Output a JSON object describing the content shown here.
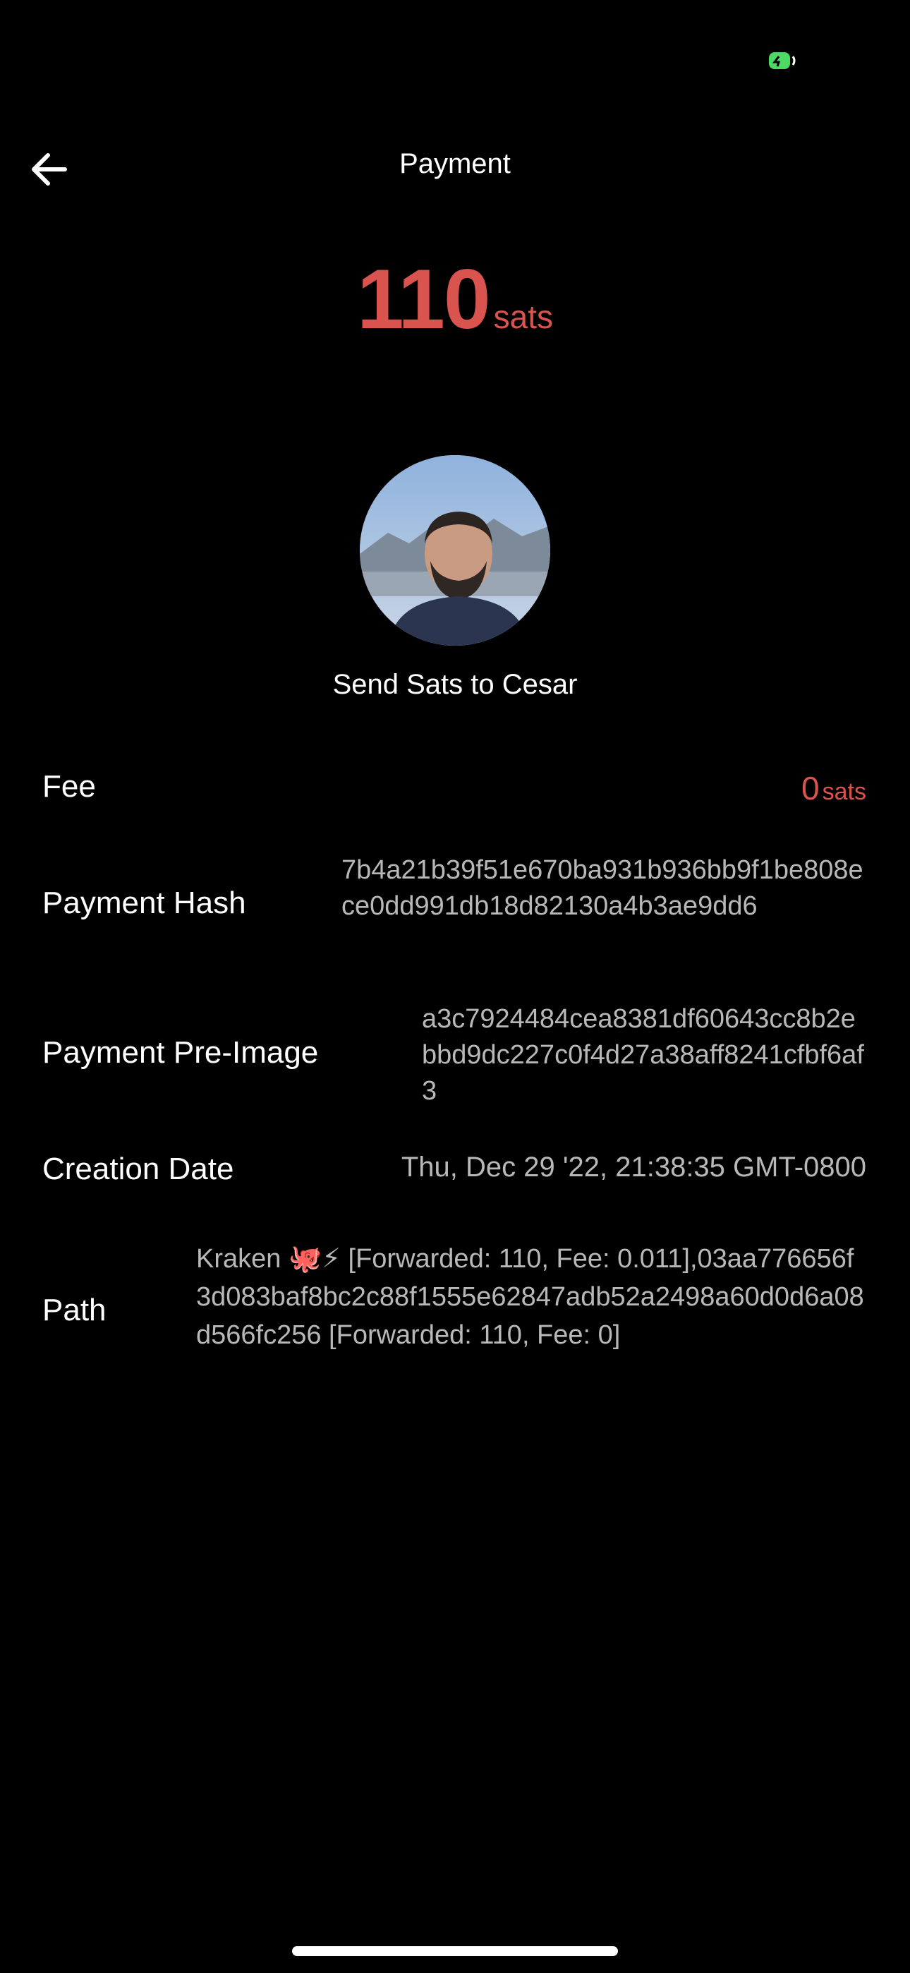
{
  "header": {
    "title": "Payment"
  },
  "payment": {
    "amount": "110",
    "amount_unit": "sats",
    "contact_name": "Send Sats to Cesar"
  },
  "details": {
    "fee": {
      "label": "Fee",
      "amount": "0",
      "unit": "sats"
    },
    "payment_hash": {
      "label": "Payment Hash",
      "value": "7b4a21b39f51e670ba931b936bb9f1be808ece0dd991db18d82130a4b3ae9dd6"
    },
    "pre_image": {
      "label": "Payment Pre-Image",
      "value": "a3c7924484cea8381df60643cc8b2ebbd9dc227c0f4d27a38aff8241cfbf6af3"
    },
    "creation_date": {
      "label": "Creation Date",
      "value": "Thu, Dec 29 '22, 21:38:35 GMT-0800"
    },
    "path": {
      "label": "Path",
      "value": "Kraken 🐙⚡ [Forwarded: 110, Fee: 0.011],03aa776656f3d083baf8bc2c88f1555e62847adb52a2498a60d0d6a08d566fc256 [Forwarded: 110, Fee: 0]"
    }
  },
  "colors": {
    "accent": "#d9534f",
    "background": "#000000",
    "battery": "#4cd964"
  },
  "icons": {
    "back": "arrow-left-icon",
    "battery": "battery-icon"
  }
}
